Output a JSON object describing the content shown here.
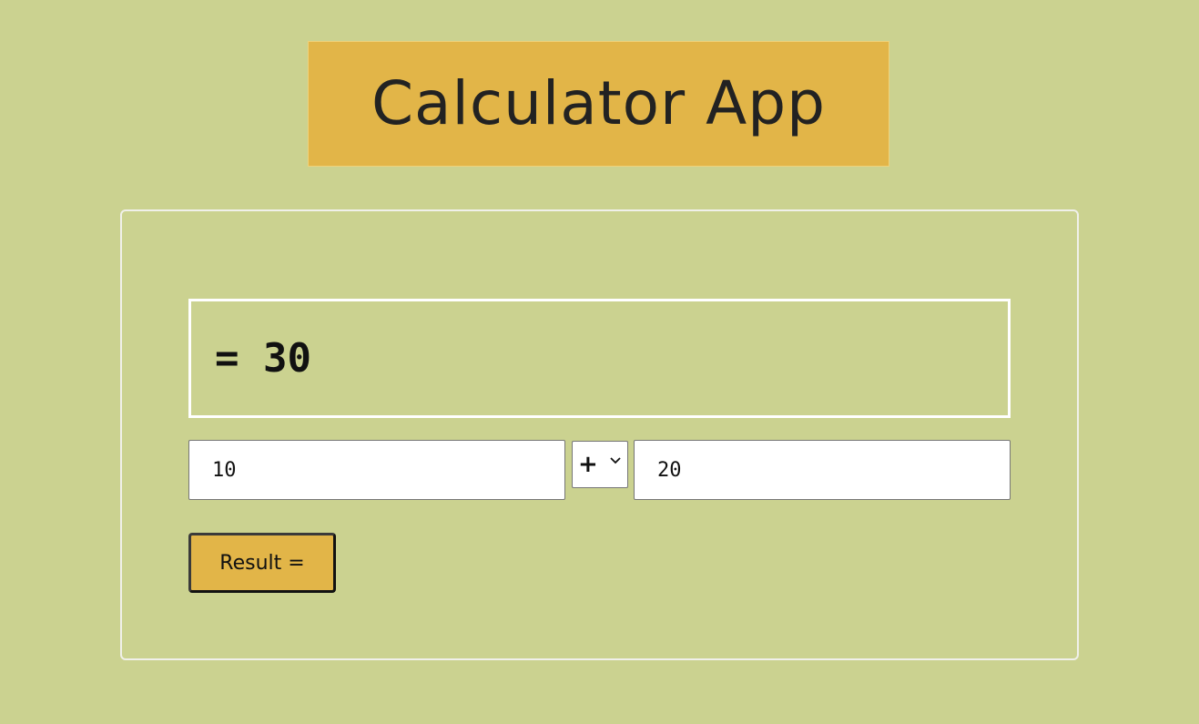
{
  "app": {
    "title": "Calculator App"
  },
  "display": {
    "text": "= 30"
  },
  "inputs": {
    "first_value": "10",
    "second_value": "20"
  },
  "operator": {
    "selected": "+"
  },
  "buttons": {
    "result_label": "Result ="
  },
  "colors": {
    "background": "#cbd290",
    "accent": "#e2b548",
    "text": "#222222",
    "card_border": "#f0f0ea"
  },
  "icons": {
    "operator_dropdown": "chevron-down-icon"
  }
}
